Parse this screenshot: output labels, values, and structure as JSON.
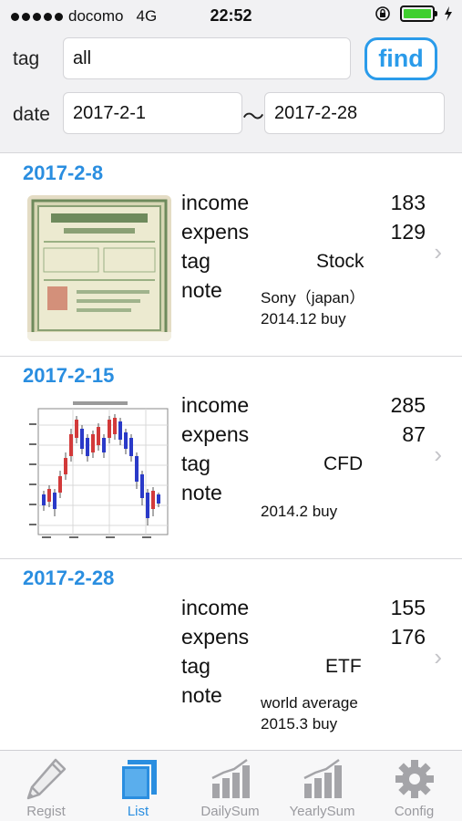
{
  "status": {
    "carrier": "docomo",
    "network": "4G",
    "time": "22:52"
  },
  "filter": {
    "tag_label": "tag",
    "tag_value": "all",
    "find_label": "find",
    "date_label": "date",
    "date_from": "2017-2-1",
    "date_separator": "〜",
    "date_to": "2017-2-28"
  },
  "entries": [
    {
      "date": "2017-2-8",
      "income_label": "income",
      "income": "183",
      "expens_label": "expens",
      "expens": "129",
      "tag_label": "tag",
      "tag": "Stock",
      "note_label": "note",
      "note_line1": "Sony（japan）",
      "note_line2": "2014.12  buy",
      "thumbnail": "stock-certificate-image"
    },
    {
      "date": "2017-2-15",
      "income_label": "income",
      "income": "285",
      "expens_label": "expens",
      "expens": "87",
      "tag_label": "tag",
      "tag": "CFD",
      "note_label": "note",
      "note_line1": "",
      "note_line2": "2014.2  buy",
      "thumbnail": "candlestick-chart-image"
    },
    {
      "date": "2017-2-28",
      "income_label": "income",
      "income": "155",
      "expens_label": "expens",
      "expens": "176",
      "tag_label": "tag",
      "tag": "ETF",
      "note_label": "note",
      "note_line1": "world average",
      "note_line2": "2015.3  buy",
      "thumbnail": ""
    }
  ],
  "tabs": [
    {
      "label": "Regist",
      "icon": "pencil-icon",
      "active": false
    },
    {
      "label": "List",
      "icon": "list-icon",
      "active": true
    },
    {
      "label": "DailySum",
      "icon": "bar-chart-icon",
      "active": false
    },
    {
      "label": "YearlySum",
      "icon": "bar-chart-icon",
      "active": false
    },
    {
      "label": "Config",
      "icon": "gear-icon",
      "active": false
    }
  ],
  "colors": {
    "accent": "#2a8ee0",
    "find_button": "#2a9bea",
    "battery": "#3fcf2e",
    "inactive_tab": "#9a9a9f"
  }
}
